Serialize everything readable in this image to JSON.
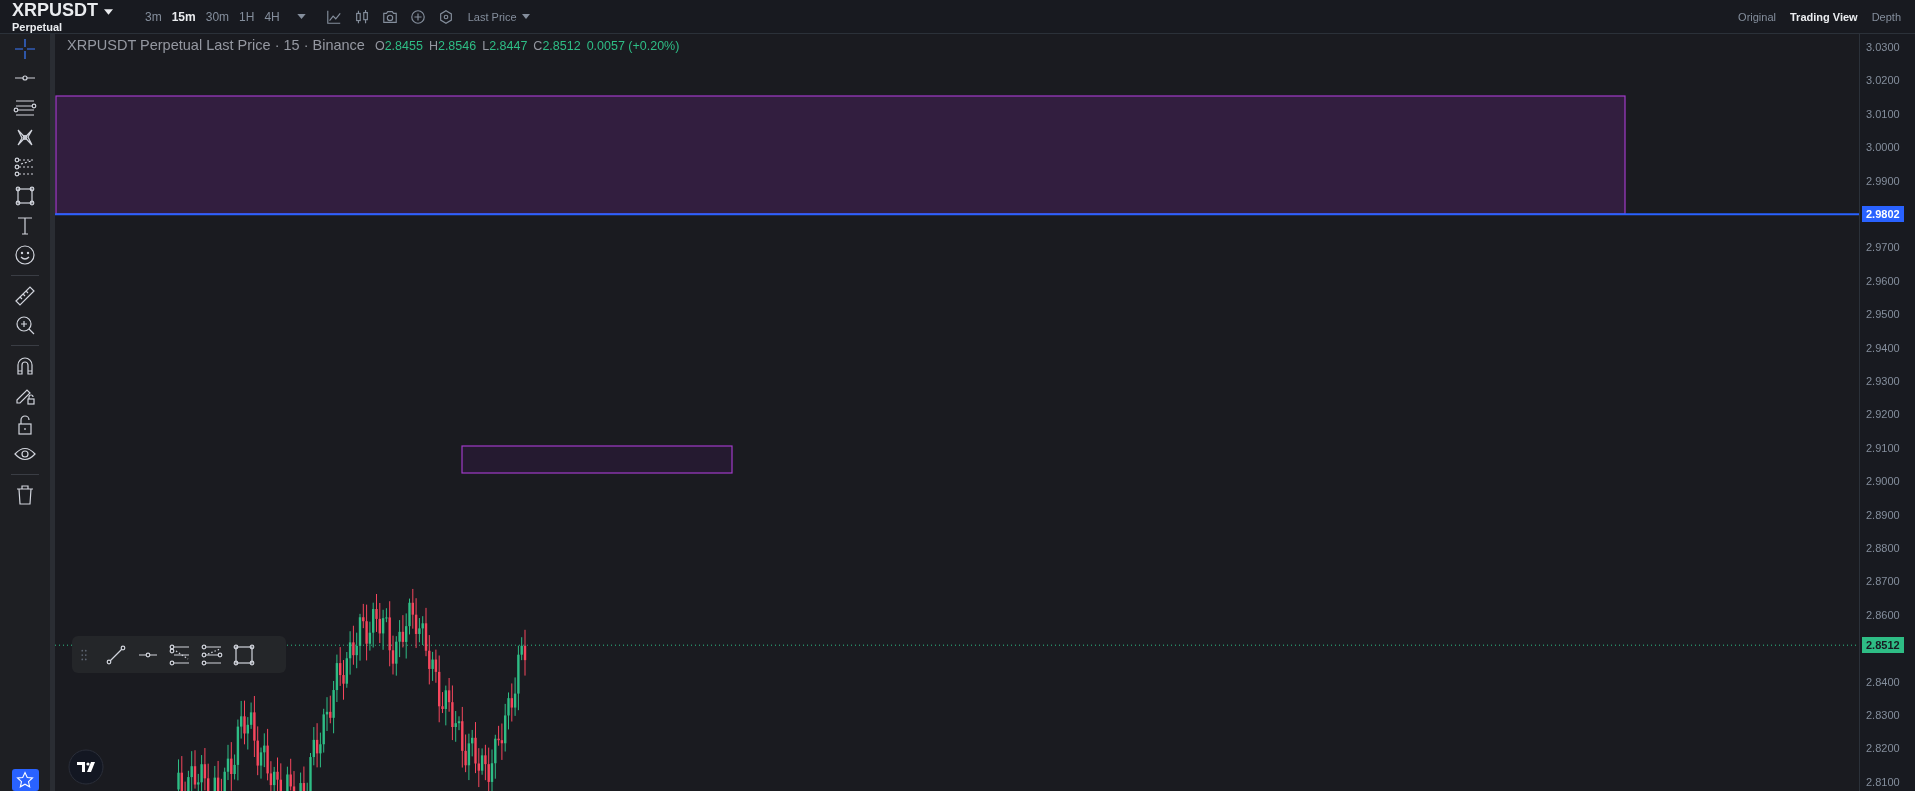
{
  "header": {
    "symbol": "XRPUSDT",
    "contract": "Perpetual",
    "intervals": [
      {
        "label": "3m",
        "selected": false
      },
      {
        "label": "15m",
        "selected": true
      },
      {
        "label": "30m",
        "selected": false
      },
      {
        "label": "1H",
        "selected": false
      },
      {
        "label": "4H",
        "selected": false
      }
    ],
    "tools": [
      {
        "kind": "indicator"
      },
      {
        "kind": "candles"
      },
      {
        "kind": "camera"
      },
      {
        "kind": "add"
      },
      {
        "kind": "settings"
      }
    ],
    "price_type": "Last Price",
    "views": [
      {
        "label": "Original",
        "selected": false
      },
      {
        "label": "Trading View",
        "selected": true
      },
      {
        "label": "Depth",
        "selected": false
      }
    ]
  },
  "left_toolbar": {
    "groups": [
      {
        "tools": [
          {
            "kind": "crosshair",
            "selected": true
          },
          {
            "kind": "horizontal-line",
            "selected": false
          },
          {
            "kind": "parallel-lines",
            "selected": false
          },
          {
            "kind": "pattern",
            "selected": false
          },
          {
            "kind": "fib",
            "selected": false
          },
          {
            "kind": "rectangle",
            "selected": false
          },
          {
            "kind": "text",
            "selected": false
          },
          {
            "kind": "emoji",
            "selected": false
          }
        ]
      },
      {
        "tools": [
          {
            "kind": "ruler",
            "selected": false
          },
          {
            "kind": "zoom-in",
            "selected": false
          }
        ]
      },
      {
        "tools": [
          {
            "kind": "magnet",
            "selected": false
          },
          {
            "kind": "lock-drawing",
            "selected": false
          },
          {
            "kind": "lock",
            "selected": false
          },
          {
            "kind": "eye",
            "selected": false
          }
        ]
      },
      {
        "tools": [
          {
            "kind": "trash",
            "selected": false
          }
        ]
      }
    ]
  },
  "legend": {
    "title": "XRPUSDT Perpetual Last Price · 15 · Binance",
    "ohlc": [
      {
        "label": "O",
        "value": "2.8455"
      },
      {
        "label": "H",
        "value": "2.8546"
      },
      {
        "label": "L",
        "value": "2.8447"
      },
      {
        "label": "C",
        "value": "2.8512"
      }
    ],
    "change": "0.0057 (+0.20%)"
  },
  "floating_toolbar": {
    "tools": [
      {
        "kind": "grip"
      },
      {
        "kind": "trend-line"
      },
      {
        "kind": "horizontal-ray"
      },
      {
        "kind": "fib-retracement"
      },
      {
        "kind": "fib-extension"
      },
      {
        "kind": "rectangle"
      }
    ]
  },
  "price_axis": {
    "ticks": [
      "3.0300",
      "3.0200",
      "3.0100",
      "3.0000",
      "2.9900",
      "2.9700",
      "2.9600",
      "2.9500",
      "2.9400",
      "2.9300",
      "2.9200",
      "2.9100",
      "2.9000",
      "2.8900",
      "2.8800",
      "2.8700",
      "2.8600",
      "2.8400",
      "2.8300",
      "2.8200",
      "2.8100"
    ],
    "markers": [
      {
        "price": "2.9802",
        "kind": "line",
        "color": "#2962ff"
      },
      {
        "price": "2.8512",
        "kind": "last",
        "color": "#2ebd85"
      }
    ]
  }
}
